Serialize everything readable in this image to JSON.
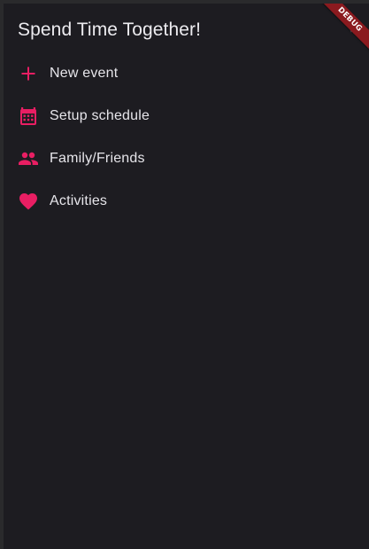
{
  "app": {
    "title": "Spend Time Together!",
    "debug_banner": "DEBUG"
  },
  "menu": {
    "items": [
      {
        "label": "New event",
        "icon": "add-icon"
      },
      {
        "label": "Setup schedule",
        "icon": "calendar-icon"
      },
      {
        "label": "Family/Friends",
        "icon": "people-icon"
      },
      {
        "label": "Activities",
        "icon": "heart-icon"
      }
    ]
  },
  "colors": {
    "accent": "#e91e63",
    "background": "#1d1c21",
    "text": "#e6e5ea",
    "banner": "#8b1a1f"
  }
}
